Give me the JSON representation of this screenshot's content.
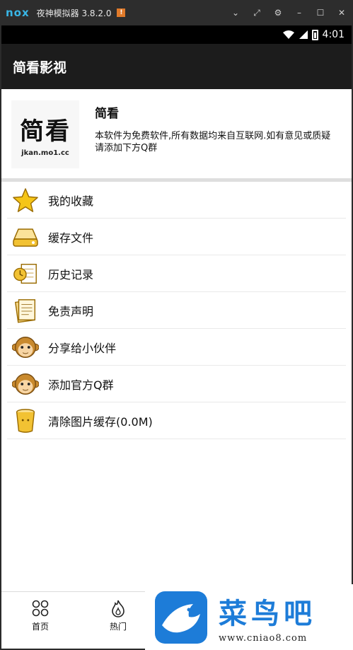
{
  "emulator": {
    "logo": "nox",
    "title": "夜神模拟器 3.8.2.0",
    "badge": "!",
    "controls": [
      "chevron-down",
      "pin",
      "gear",
      "minimize",
      "maximize",
      "close"
    ]
  },
  "status_bar": {
    "time": "4:01"
  },
  "toolbar": {
    "title": "简看影视"
  },
  "about": {
    "logo_text": "简看",
    "logo_url": "jkan.mo1.cc",
    "name": "简看",
    "description": "本软件为免费软件,所有数据均来自互联网.如有意见或质疑请添加下方Q群"
  },
  "menu": {
    "items": [
      {
        "label": "我的收藏",
        "icon": "star-icon"
      },
      {
        "label": "缓存文件",
        "icon": "drive-icon"
      },
      {
        "label": "历史记录",
        "icon": "history-icon"
      },
      {
        "label": "免责声明",
        "icon": "document-icon"
      },
      {
        "label": "分享给小伙伴",
        "icon": "monkey-icon"
      },
      {
        "label": "添加官方Q群",
        "icon": "monkey-icon"
      },
      {
        "label": "清除图片缓存(0.0M)",
        "icon": "trash-icon"
      }
    ]
  },
  "bottom_nav": {
    "items": [
      {
        "label": "首页",
        "icon": "home-grid-icon"
      },
      {
        "label": "热门",
        "icon": "flame-icon"
      }
    ]
  },
  "watermark": {
    "name": "菜鸟吧",
    "url": "www.cniao8.com"
  },
  "colors": {
    "accent": "#1d7cd8",
    "toolbar": "#1c1c1c",
    "star": "#f5c518"
  }
}
